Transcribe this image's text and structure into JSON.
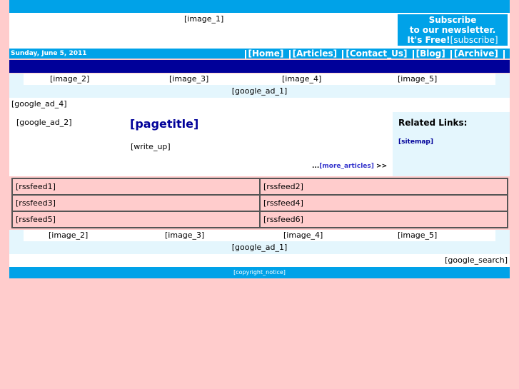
{
  "header": {
    "image_1": "[image_1]",
    "subscribe_line1": "Subscribe",
    "subscribe_line2": "to our newsletter.",
    "subscribe_line3": "It's Free!",
    "subscribe_link": "[subscribe]"
  },
  "nav": {
    "date": "Sunday, June 5, 2011",
    "items": [
      "[Home]",
      "[Articles]",
      "[Contact_Us]",
      "[Blog]",
      "[Archive]"
    ]
  },
  "images_top": [
    "[image_2]",
    "[image_3]",
    "[image_4]",
    "[image_5]"
  ],
  "google_ad_1": "[google_ad_1]",
  "google_ad_4": "[google_ad_4]",
  "content": {
    "google_ad_2": "[google_ad_2]",
    "pagetitle": "[pagetitle]",
    "write_up": "[write_up]",
    "more_prefix": "...",
    "more_link": "[more_articles]",
    "more_suffix": " >>"
  },
  "related": {
    "heading": "Related Links:",
    "sitemap": "[sitemap]"
  },
  "feeds": [
    "[rssfeed1]",
    "[rssfeed2]",
    "[rssfeed3]",
    "[rssfeed4]",
    "[rssfeed5]",
    "[rssfeed6]"
  ],
  "images_bottom": [
    "[image_2]",
    "[image_3]",
    "[image_4]",
    "[image_5]"
  ],
  "google_ad_1_bottom": "[google_ad_1]",
  "google_search": "[google_search]",
  "footer": {
    "copyright": "[copyright_notice]"
  }
}
